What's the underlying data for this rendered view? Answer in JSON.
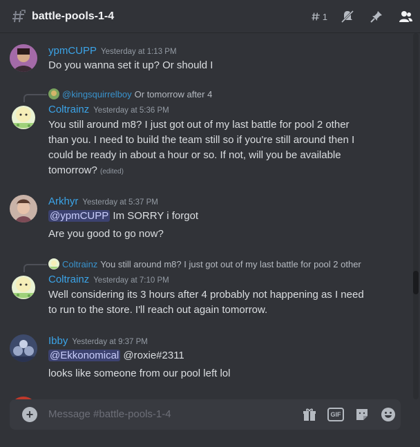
{
  "channel": {
    "name": "battle-pools-1-4",
    "thread_count": "1"
  },
  "messages": [
    {
      "author": "ypmCUPP",
      "timestamp": "Yesterday at 1:13 PM",
      "lines": [
        "Do you wanna set it up? Or should I"
      ],
      "avatar_color": "#6b3f6f"
    },
    {
      "reply_to_name": "@kingsquirrelboy",
      "reply_to_text": "Or tomorrow after 4",
      "author": "Coltrainz",
      "timestamp": "Yesterday at 5:36 PM",
      "lines": [
        "You still around m8? I just got out of my last battle for pool 2 other",
        "than you. I need to build the team still so if you're still around then I",
        "could be ready in about a hour or so. If not, will you be available",
        "tomorrow?"
      ],
      "edited": "(edited)"
    },
    {
      "author": "Arkhyr",
      "timestamp": "Yesterday at 5:37 PM",
      "mention": "@ypmCUPP",
      "line1_rest": " Im SORRY i forgot",
      "line2": "Are you good to go now?"
    },
    {
      "reply_to_name": "Coltrainz",
      "reply_to_text": "You still around m8? I just got out of my last battle for pool 2 other",
      "author": "Coltrainz",
      "timestamp": "Yesterday at 7:10 PM",
      "lines": [
        "Well considering its 3 hours after 4 probably not happening as I need",
        "to run to the store. I'll reach out again tomorrow."
      ]
    },
    {
      "author": "Ibby",
      "timestamp": "Yesterday at 9:37 PM",
      "mention": "@Ekkonomical",
      "line1_rest": " @roxie#2311",
      "line2": "looks like someone from our pool left lol"
    }
  ],
  "composer": {
    "placeholder": "Message #battle-pools-1-4"
  },
  "colors": {
    "background": "#313338",
    "username": "#3ba4e8",
    "mention_bg": "#3c4270"
  }
}
